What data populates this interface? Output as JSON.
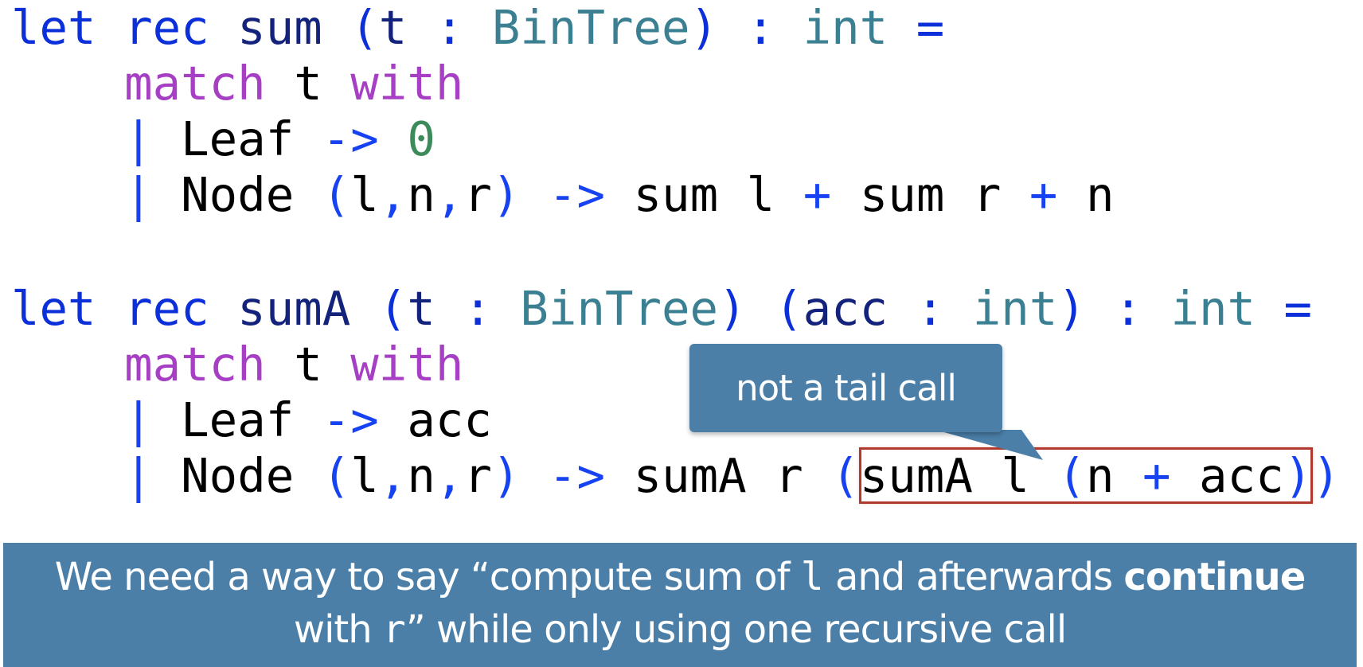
{
  "code1": [
    {
      "segs": [
        {
          "t": "let rec ",
          "c": "kw"
        },
        {
          "t": "sum ",
          "c": "id"
        },
        {
          "t": "(",
          "c": "kw"
        },
        {
          "t": "t ",
          "c": "id"
        },
        {
          "t": ": ",
          "c": "kw"
        },
        {
          "t": "BinTree",
          "c": "ty"
        },
        {
          "t": ") : ",
          "c": "kw"
        },
        {
          "t": "int",
          "c": "ty"
        },
        {
          "t": " =",
          "c": "kw"
        }
      ]
    },
    {
      "segs": [
        {
          "t": "    "
        },
        {
          "t": "match",
          "c": "mt"
        },
        {
          "t": " t "
        },
        {
          "t": "with",
          "c": "mt"
        }
      ]
    },
    {
      "segs": [
        {
          "t": "    "
        },
        {
          "t": "|",
          "c": "op"
        },
        {
          "t": " Leaf "
        },
        {
          "t": "->",
          "c": "op"
        },
        {
          "t": " "
        },
        {
          "t": "0",
          "c": "num"
        }
      ]
    },
    {
      "segs": [
        {
          "t": "    "
        },
        {
          "t": "|",
          "c": "op"
        },
        {
          "t": " Node "
        },
        {
          "t": "(",
          "c": "op"
        },
        {
          "t": "l"
        },
        {
          "t": ",",
          "c": "op"
        },
        {
          "t": "n"
        },
        {
          "t": ",",
          "c": "op"
        },
        {
          "t": "r"
        },
        {
          "t": ")",
          "c": "op"
        },
        {
          "t": " "
        },
        {
          "t": "->",
          "c": "op"
        },
        {
          "t": " sum l "
        },
        {
          "t": "+",
          "c": "op"
        },
        {
          "t": " sum r "
        },
        {
          "t": "+",
          "c": "op"
        },
        {
          "t": " n"
        }
      ]
    }
  ],
  "code2": [
    {
      "segs": [
        {
          "t": "let rec ",
          "c": "kw"
        },
        {
          "t": "sumA ",
          "c": "id"
        },
        {
          "t": "(",
          "c": "kw"
        },
        {
          "t": "t ",
          "c": "id"
        },
        {
          "t": ": ",
          "c": "kw"
        },
        {
          "t": "BinTree",
          "c": "ty"
        },
        {
          "t": ") (",
          "c": "kw"
        },
        {
          "t": "acc ",
          "c": "id"
        },
        {
          "t": ": ",
          "c": "kw"
        },
        {
          "t": "int",
          "c": "ty"
        },
        {
          "t": ") : ",
          "c": "kw"
        },
        {
          "t": "int",
          "c": "ty"
        },
        {
          "t": " =",
          "c": "kw"
        }
      ]
    },
    {
      "segs": [
        {
          "t": "    "
        },
        {
          "t": "match",
          "c": "mt"
        },
        {
          "t": " t "
        },
        {
          "t": "with",
          "c": "mt"
        }
      ]
    },
    {
      "segs": [
        {
          "t": "    "
        },
        {
          "t": "|",
          "c": "op"
        },
        {
          "t": " Leaf "
        },
        {
          "t": "->",
          "c": "op"
        },
        {
          "t": " acc"
        }
      ]
    },
    {
      "segs": [
        {
          "t": "    "
        },
        {
          "t": "|",
          "c": "op"
        },
        {
          "t": " Node "
        },
        {
          "t": "(",
          "c": "op"
        },
        {
          "t": "l"
        },
        {
          "t": ",",
          "c": "op"
        },
        {
          "t": "n"
        },
        {
          "t": ",",
          "c": "op"
        },
        {
          "t": "r"
        },
        {
          "t": ")",
          "c": "op"
        },
        {
          "t": " "
        },
        {
          "t": "->",
          "c": "op"
        },
        {
          "t": " sumA r "
        },
        {
          "t": "(",
          "c": "op"
        },
        {
          "t": "sumA l ",
          "hl": "start"
        },
        {
          "t": "(",
          "c": "op",
          "hl": "in"
        },
        {
          "t": "n ",
          "hl": "in"
        },
        {
          "t": "+",
          "c": "op",
          "hl": "in"
        },
        {
          "t": " acc",
          "hl": "in"
        },
        {
          "t": ")",
          "c": "op",
          "hl": "end"
        },
        {
          "t": ")",
          "c": "op"
        }
      ]
    }
  ],
  "callout": {
    "text": "not a tail call"
  },
  "banner": {
    "line1_before": "We need a way to say “compute sum of ",
    "line1_code": "l",
    "line1_after": " and afterwards ",
    "line1_bold": "continue",
    "line2_before": "with ",
    "line2_code": "r",
    "line2_after": "” while only using one recursive call"
  },
  "colors": {
    "keyword": "#0b2fd8",
    "identifier": "#13227a",
    "type": "#3b7f93",
    "match": "#a63fc4",
    "operator": "#1642f2",
    "number": "#3d8a5b",
    "panel": "#4b7fa8",
    "highlight_border": "#b2392e"
  }
}
